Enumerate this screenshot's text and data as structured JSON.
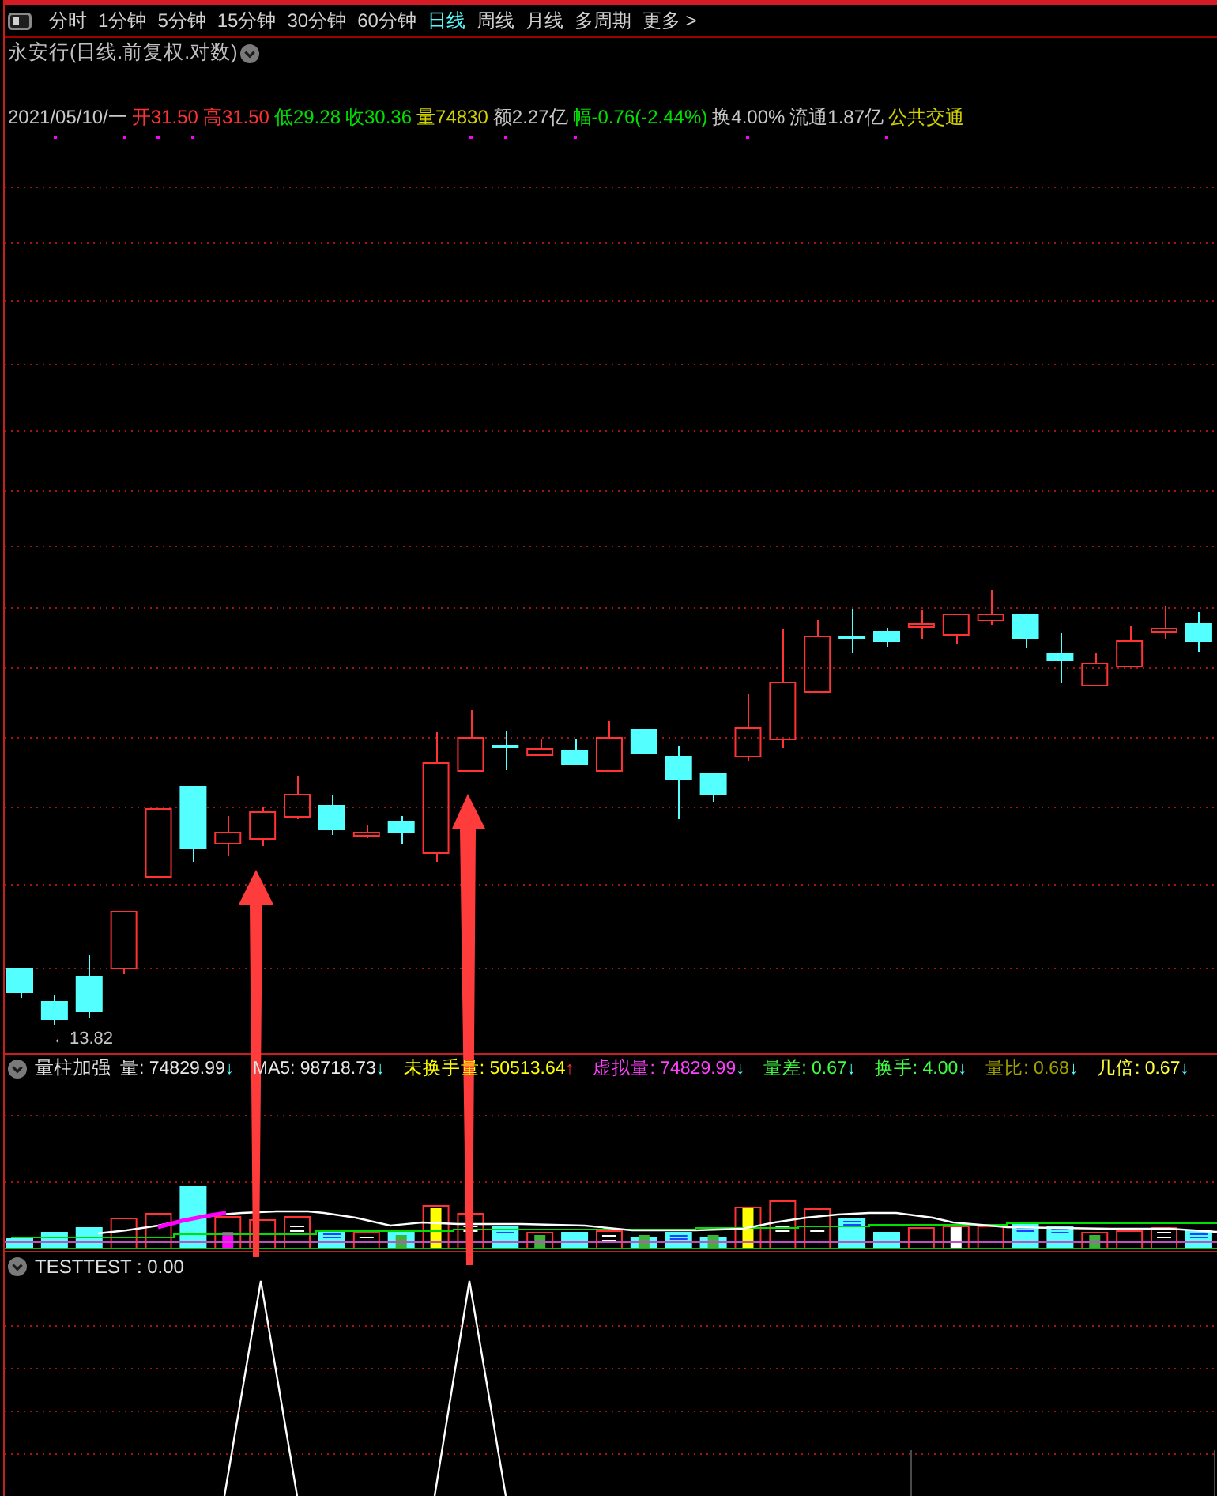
{
  "toolbar": {
    "tabs": [
      {
        "label": "分时",
        "selected": false
      },
      {
        "label": "1分钟",
        "selected": false
      },
      {
        "label": "5分钟",
        "selected": false
      },
      {
        "label": "15分钟",
        "selected": false
      },
      {
        "label": "30分钟",
        "selected": false
      },
      {
        "label": "60分钟",
        "selected": false
      },
      {
        "label": "日线",
        "selected": true
      },
      {
        "label": "周线",
        "selected": false
      },
      {
        "label": "月线",
        "selected": false
      },
      {
        "label": "多周期",
        "selected": false
      },
      {
        "label": "更多 >",
        "selected": false
      }
    ]
  },
  "chart_title": "永安行(日线.前复权.对数)",
  "quote": [
    {
      "text": "2021/05/10/一",
      "color": "#c8c8c8"
    },
    {
      "text": "开31.50",
      "color": "#ff3232"
    },
    {
      "text": "高31.50",
      "color": "#ff3232"
    },
    {
      "text": "低29.28",
      "color": "#00e000"
    },
    {
      "text": "收30.36",
      "color": "#00e000"
    },
    {
      "text": "量74830",
      "color": "#d2d200"
    },
    {
      "text": "额2.27亿",
      "color": "#c8c8c8"
    },
    {
      "text": "幅-0.76(-2.44%)",
      "color": "#00e000"
    },
    {
      "text": "换4.00%",
      "color": "#c8c8c8"
    },
    {
      "text": "流通1.87亿",
      "color": "#c8c8c8"
    },
    {
      "text": "公共交通",
      "color": "#d2d200"
    }
  ],
  "price_chart": {
    "low_label": "←13.82"
  },
  "volume_panel": {
    "name": "量柱加强",
    "items": [
      {
        "text": "量: 74829.99",
        "color": "#e8e8e8",
        "arrow": "↓",
        "rising": false
      },
      {
        "text": "MA5: 98718.73",
        "color": "#e8e8e8",
        "arrow": "↓",
        "rising": false
      },
      {
        "text": "未换手量: 50513.64",
        "color": "#ffff00",
        "arrow": "↑",
        "rising": true
      },
      {
        "text": "虚拟量: 74829.99",
        "color": "#ff40ff",
        "arrow": "↓",
        "rising": false
      },
      {
        "text": "量差: 0.67",
        "color": "#40ff40",
        "arrow": "↓",
        "rising": false
      },
      {
        "text": "换手: 4.00",
        "color": "#40ff40",
        "arrow": "↓",
        "rising": false
      },
      {
        "text": "量比: 0.68",
        "color": "#a0a000",
        "arrow": "↓",
        "rising": false
      },
      {
        "text": "几倍: 0.67",
        "color": "#ffff40",
        "arrow": "↓",
        "rising": false
      }
    ]
  },
  "signal_panel": {
    "text": "TESTTEST : 0.00"
  }
}
